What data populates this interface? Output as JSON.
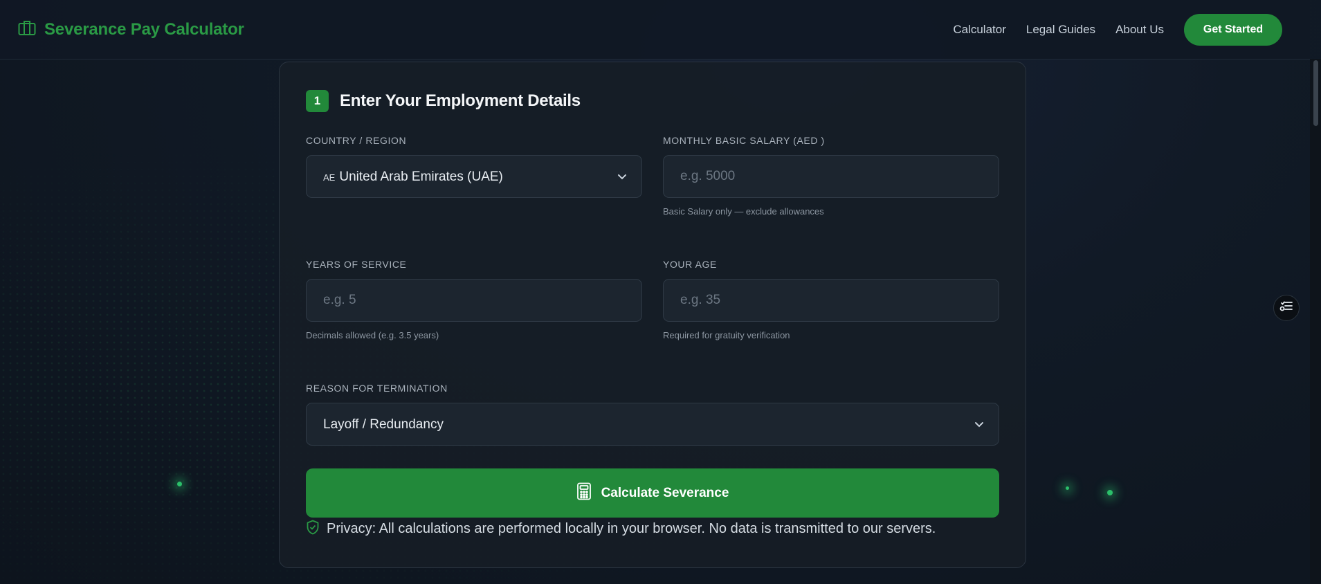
{
  "header": {
    "brand": "Severance Pay Calculator",
    "nav": [
      "Calculator",
      "Legal Guides",
      "About Us"
    ],
    "cta": "Get Started"
  },
  "form": {
    "step_number": "1",
    "step_title": "Enter Your Employment Details",
    "country": {
      "label": "COUNTRY / REGION",
      "flag_code": "AE",
      "value": "United Arab Emirates (UAE)"
    },
    "salary": {
      "label": "MONTHLY BASIC SALARY (AED )",
      "placeholder": "e.g. 5000",
      "help": "Basic Salary only — exclude allowances"
    },
    "years": {
      "label": "YEARS OF SERVICE",
      "placeholder": "e.g. 5",
      "help": "Decimals allowed (e.g. 3.5 years)"
    },
    "age": {
      "label": "YOUR AGE",
      "placeholder": "e.g. 35",
      "help": "Required for gratuity verification"
    },
    "reason": {
      "label": "REASON FOR TERMINATION",
      "value": "Layoff / Redundancy"
    },
    "submit_label": "Calculate Severance",
    "privacy": "Privacy: All calculations are performed locally in your browser. No data is transmitted to our servers."
  },
  "icons": {
    "brand": "briefcase-icon",
    "calculator": "calculator-icon",
    "privacy": "shield-check-icon",
    "select": "chevron-down-icon",
    "floating": "settings-list-icon"
  },
  "colors": {
    "accent": "#22893a",
    "brand_text": "#2a9a45",
    "background": "#111a26",
    "card": "#161d26"
  }
}
